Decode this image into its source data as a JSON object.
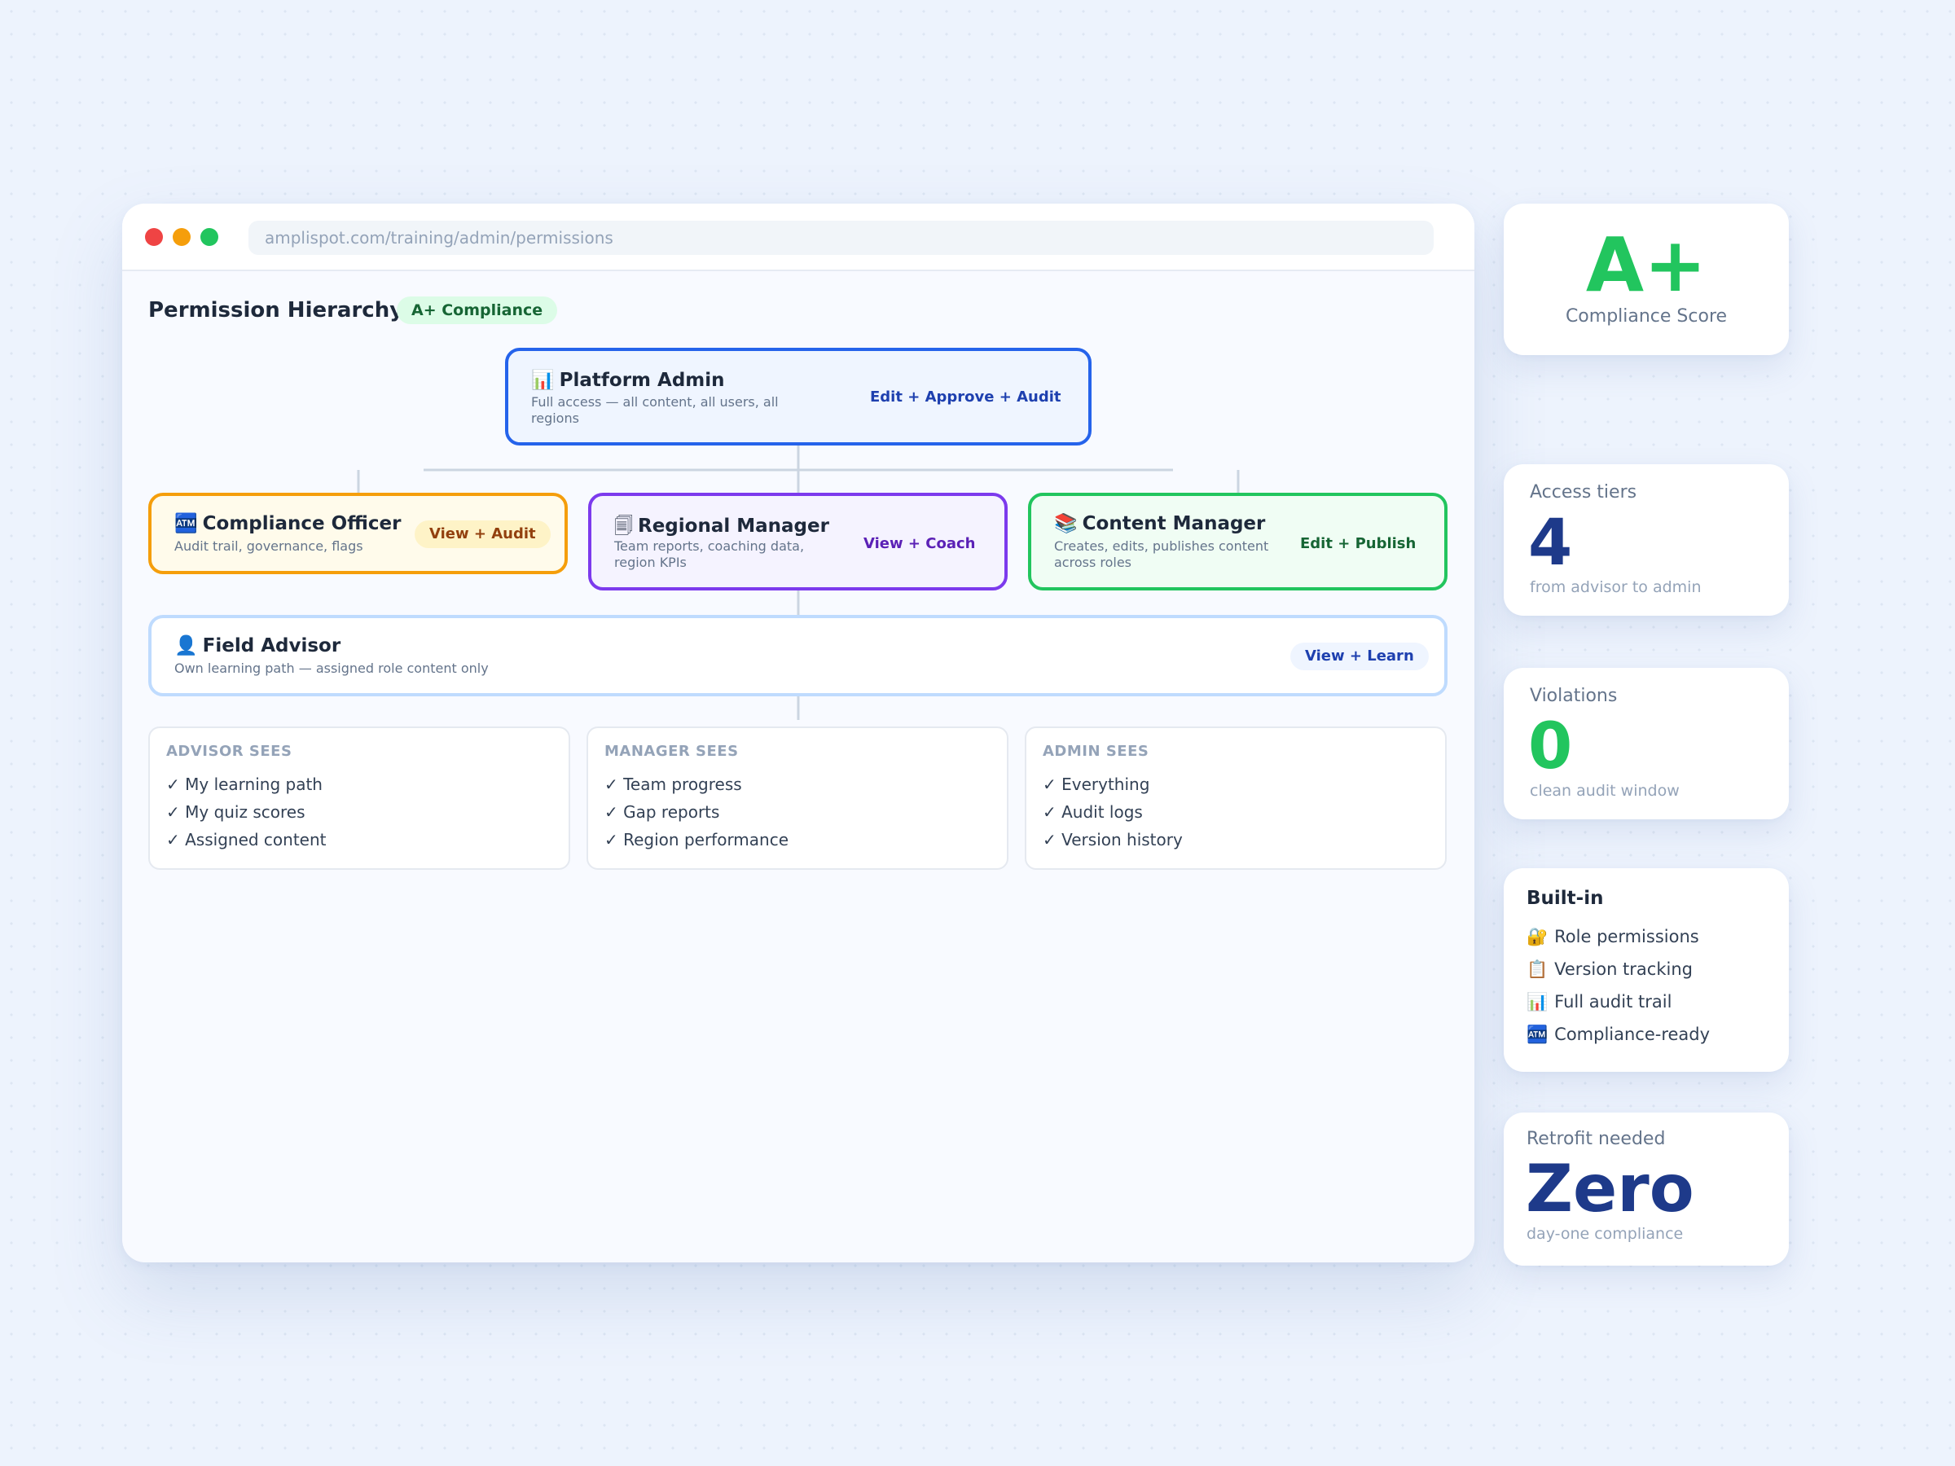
{
  "browser": {
    "url": "amplispot.com/training/admin/permissions"
  },
  "page": {
    "title": "Permission Hierarchy",
    "badge": "A+ Compliance"
  },
  "roles": {
    "admin": {
      "icon": "📊",
      "name": "Platform Admin",
      "description": "Full access — all content, all users, all regions",
      "permission": "Edit + Approve + Audit",
      "border_color": "#2563eb"
    },
    "compliance_officer": {
      "icon": "🏧",
      "name": "Compliance Officer",
      "description": "Audit trail, governance, flags",
      "permission": "View + Audit",
      "border_color": "#f59e0b"
    },
    "regional_manager": {
      "icon": "🗐",
      "name": "Regional Manager",
      "description": "Team reports, coaching data, region KPIs",
      "permission": "View + Coach",
      "border_color": "#7c3aed"
    },
    "content_manager": {
      "icon": "📚",
      "name": "Content Manager",
      "description": "Creates, edits, publishes content across roles",
      "permission": "Edit + Publish",
      "border_color": "#22c55e"
    },
    "field_advisor": {
      "icon": "👤",
      "name": "Field Advisor",
      "description": "Own learning path — assigned role content only",
      "permission": "View + Learn",
      "border_color": "#bfdbfe"
    }
  },
  "sees": {
    "advisor": {
      "heading": "ADVISOR SEES",
      "items": [
        "✓ My learning path",
        "✓ My quiz scores",
        "✓ Assigned content"
      ]
    },
    "manager": {
      "heading": "MANAGER SEES",
      "items": [
        "✓ Team progress",
        "✓ Gap reports",
        "✓ Region performance"
      ]
    },
    "admin": {
      "heading": "ADMIN SEES",
      "items": [
        "✓ Everything",
        "✓ Audit logs",
        "✓ Version history"
      ]
    }
  },
  "sidebar": {
    "score": {
      "value": "A+",
      "label": "Compliance Score"
    },
    "tiers": {
      "label": "Access tiers",
      "value": "4",
      "sub": "from advisor to admin"
    },
    "violations": {
      "label": "Violations",
      "value": "0",
      "sub": "clean audit window"
    },
    "builtin": {
      "heading": "Built-in",
      "items": [
        {
          "icon": "🔐",
          "label": "Role permissions"
        },
        {
          "icon": "📋",
          "label": "Version tracking"
        },
        {
          "icon": "📊",
          "label": "Full audit trail"
        },
        {
          "icon": "🏧",
          "label": "Compliance-ready"
        }
      ]
    },
    "retrofit": {
      "label": "Retrofit needed",
      "value": "Zero",
      "sub": "day-one compliance"
    }
  },
  "colors": {
    "accent_green": "#22c55e",
    "accent_navy": "#1e3a8a",
    "connector": "#cbd5e1"
  }
}
